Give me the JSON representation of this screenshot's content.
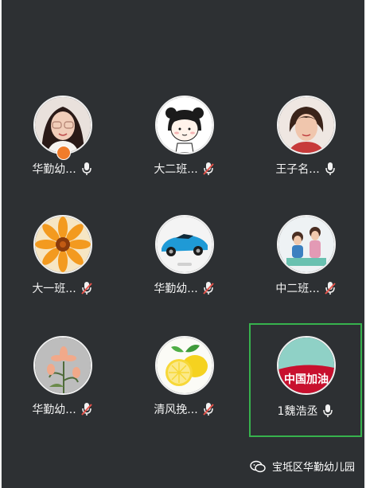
{
  "participants": [
    {
      "name": "华勤幼...",
      "mic": "on",
      "avatar": "woman-glasses-photo",
      "host": true
    },
    {
      "name": "大二班...",
      "mic": "muted",
      "avatar": "cartoon-girl-drawing"
    },
    {
      "name": "王子名...",
      "mic": "on",
      "avatar": "woman-short-hair-photo"
    },
    {
      "name": "大一班...",
      "mic": "muted",
      "avatar": "orange-flower"
    },
    {
      "name": "华勤幼...",
      "mic": "muted",
      "avatar": "blue-sports-car"
    },
    {
      "name": "中二班...",
      "mic": "muted",
      "avatar": "children-photo"
    },
    {
      "name": "华勤幼...",
      "mic": "muted",
      "avatar": "flower-painting"
    },
    {
      "name": "清风挽...",
      "mic": "muted",
      "avatar": "lemons"
    },
    {
      "name": "1魏浩丞",
      "mic": "on",
      "avatar": "china-jiayou-banner",
      "speaking": true
    }
  ],
  "avatar_text": {
    "china": "中国加油"
  },
  "watermark": {
    "text": "宝坻区华勤幼儿园",
    "icon": "wechat-icon"
  },
  "colors": {
    "background": "#2d3033",
    "active_border": "#37b24d",
    "muted": "#e5534b"
  }
}
